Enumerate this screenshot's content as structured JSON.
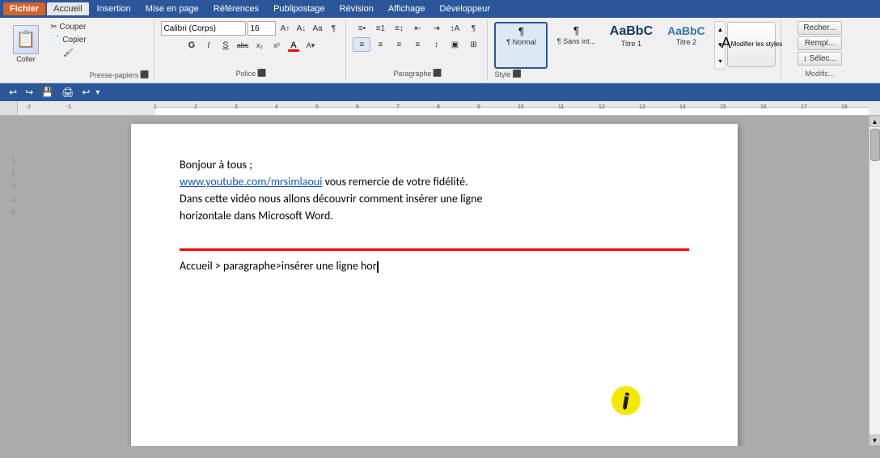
{
  "menubar": {
    "fichier": "Fichier",
    "items": [
      "Accueil",
      "Insertion",
      "Mise en page",
      "Références",
      "Publipostage",
      "Révision",
      "Affichage",
      "Développeur"
    ]
  },
  "ribbon": {
    "clipboard": {
      "label": "Presse-papiers",
      "paste": "Coller",
      "cut": "Couper",
      "copy": "Copier",
      "format_painter": "Reproduire la mise en forme"
    },
    "font": {
      "label": "Police",
      "name": "Calibri (Corps)",
      "size": "16",
      "bold": "G",
      "italic": "I",
      "underline": "S",
      "strikethrough": "abc",
      "subscript": "x₂",
      "superscript": "x²"
    },
    "paragraph": {
      "label": "Paragraphe"
    },
    "style": {
      "label": "Style",
      "items": [
        {
          "name": "¶ Normal",
          "active": true
        },
        {
          "name": "¶ Sans int...",
          "active": false
        },
        {
          "name": "Titre 1",
          "active": false,
          "large": true
        },
        {
          "name": "Titre 2",
          "active": false,
          "large": true
        }
      ],
      "modifier": "Modifier\nles styles"
    },
    "modify": {
      "label": "Modific...",
      "rechercher": "Recher...",
      "remplacer": "Rempl...",
      "selectionner": "↕ Sélec..."
    }
  },
  "quick_toolbar": {
    "items": [
      "↩",
      "↪",
      "💾",
      "🖨",
      "↩"
    ]
  },
  "document": {
    "paragraph1": "Bonjour à tous ;",
    "link": "www.youtube.com/mrsimlaoui",
    "paragraph2": " vous remercie de votre fidélité.",
    "paragraph3": "Dans cette vidéo nous allons découvrir comment insérer une ligne",
    "paragraph4": "horizontale dans Microsoft Word.",
    "instruction": "Accueil > paragraphe>insérer une ligne hor"
  },
  "ruler": {
    "markers": [
      "-2",
      "-1",
      "1",
      "2",
      "3",
      "4",
      "5",
      "6",
      "7",
      "8",
      "9",
      "10",
      "11",
      "12",
      "13",
      "14",
      "15",
      "16",
      "17",
      "18"
    ]
  }
}
